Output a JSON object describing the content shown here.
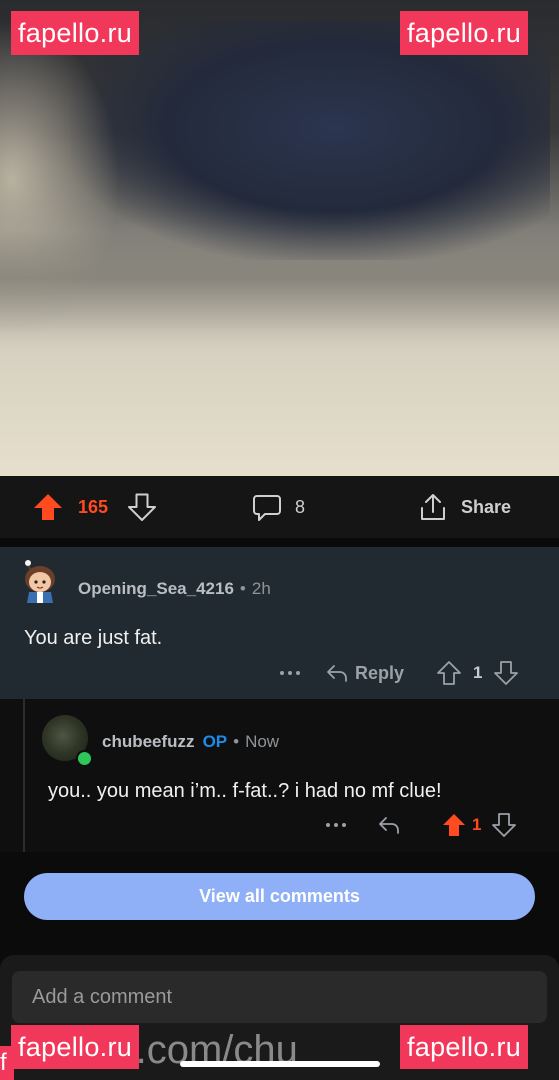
{
  "watermark": {
    "text": "fapello.ru",
    "bg_color": "#f2385a",
    "partial_char": "f"
  },
  "background_url": "fans.com/chu",
  "post_actions": {
    "score": "165",
    "comment_count": "8",
    "share_label": "Share",
    "upvote_color": "#ff4b1f"
  },
  "comments": [
    {
      "author": "Opening_Sea_4216",
      "separator": "•",
      "time": "2h",
      "body": "You are just fat.",
      "reply_label": "Reply",
      "score": "1",
      "icons": [
        "snoo-avatar-icon",
        "more-icon",
        "reply-arrow-icon",
        "upvote-outline-icon",
        "downvote-outline-icon"
      ]
    },
    {
      "author": "chubeefuzz",
      "op_badge": "OP",
      "separator": "•",
      "time": "Now",
      "body": "you.. you mean i’m.. f-fat..? i had no mf clue!",
      "score": "1",
      "online": true,
      "icons": [
        "user-avatar-icon",
        "more-icon",
        "reply-arrow-icon",
        "upvote-filled-icon",
        "downvote-outline-icon"
      ]
    }
  ],
  "view_all_label": "View all comments",
  "composer": {
    "placeholder": "Add a comment"
  },
  "colors": {
    "accent_blue": "#1c8ce8",
    "button_blue": "#8fb0f7",
    "online_green": "#2ec55a"
  }
}
